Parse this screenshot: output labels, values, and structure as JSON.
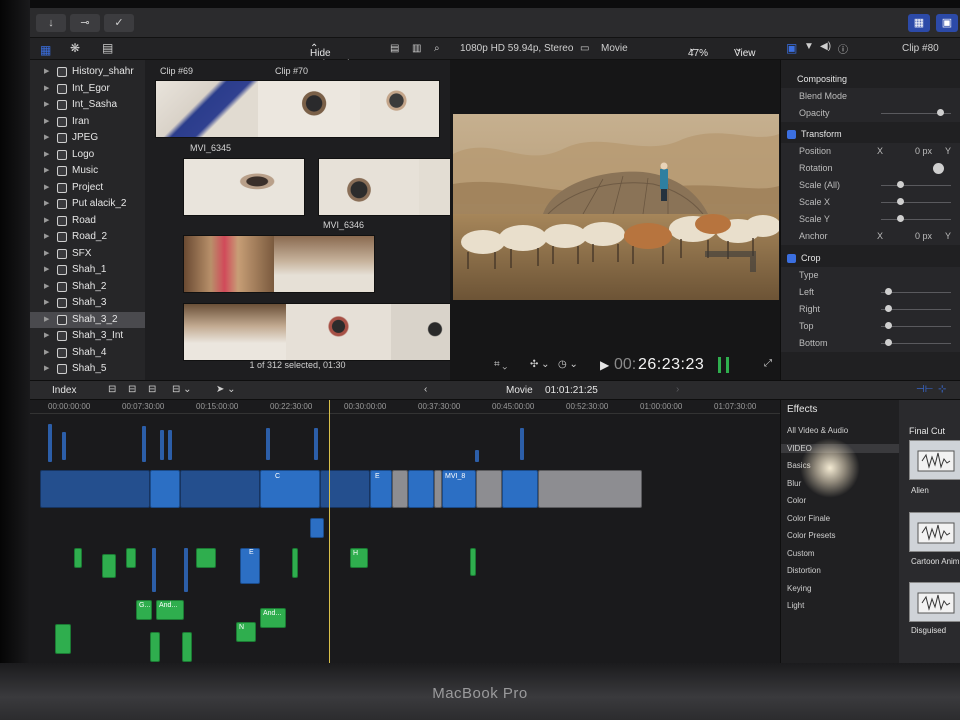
{
  "toolbar": {
    "import_icon": "↓",
    "keywords_icon": "⊸",
    "check_icon": "✓"
  },
  "library": {
    "filter": "Hide Rejected",
    "items": [
      {
        "label": "History_shahr"
      },
      {
        "label": "Int_Egor"
      },
      {
        "label": "Int_Sasha"
      },
      {
        "label": "Iran"
      },
      {
        "label": "JPEG"
      },
      {
        "label": "Logo"
      },
      {
        "label": "Music"
      },
      {
        "label": "Project"
      },
      {
        "label": "Put alacik_2"
      },
      {
        "label": "Road"
      },
      {
        "label": "Road_2"
      },
      {
        "label": "SFX"
      },
      {
        "label": "Shah_1"
      },
      {
        "label": "Shah_2"
      },
      {
        "label": "Shah_3"
      },
      {
        "label": "Shah_3_2",
        "selected": true
      },
      {
        "label": "Shah_3_Int"
      },
      {
        "label": "Shah_4"
      },
      {
        "label": "Shah_5"
      }
    ]
  },
  "browser": {
    "clip_a": "Clip #69",
    "clip_b": "Clip #70",
    "clip_c": "MVI_6345",
    "clip_d": "MVI_6346",
    "status": "1 of 312 selected, 01:30"
  },
  "viewer": {
    "format": "1080p HD 59.94p, Stereo",
    "project": "Movie",
    "zoom": "47%",
    "view": "View",
    "timecode_dim": "00:",
    "timecode": "26:23:23"
  },
  "inspector": {
    "title": "Clip #80",
    "compositing": "Compositing",
    "blend_mode": "Blend Mode",
    "opacity": "Opacity",
    "transform": "Transform",
    "position": "Position",
    "x": "X",
    "y": "Y",
    "pos_value": "0 px",
    "rotation": "Rotation",
    "scale_all": "Scale (All)",
    "scale_x": "Scale X",
    "scale_y": "Scale Y",
    "anchor": "Anchor",
    "anchor_value": "0 px",
    "crop": "Crop",
    "type": "Type",
    "left": "Left",
    "right": "Right",
    "top": "Top",
    "bottom": "Bottom"
  },
  "timeline": {
    "index": "Index",
    "project": "Movie",
    "duration": "01:01:21:25",
    "ticks": [
      "00:00:00:00",
      "00:07:30:00",
      "00:15:00:00",
      "00:22:30:00",
      "00:30:00:00",
      "00:37:30:00",
      "00:45:00:00",
      "00:52:30:00",
      "01:00:00:00",
      "01:07:30:00"
    ],
    "clip_labels": {
      "c": "C",
      "e": "E",
      "mvi": "MVI_8",
      "h": "H",
      "and1": "And...",
      "and2": "And...",
      "g": "G...",
      "n": "N"
    }
  },
  "effects": {
    "title": "Effects",
    "categories": [
      "All Video & Audio",
      "VIDEO",
      "Basics",
      "Blur",
      "Color",
      "Color Finale",
      "Color Presets",
      "Custom",
      "Distortion",
      "Keying",
      "Light"
    ],
    "group": "Final Cut",
    "tiles": [
      "Alien",
      "Cartoon Anim",
      "Disguised"
    ]
  },
  "device": {
    "label": "MacBook Pro"
  }
}
